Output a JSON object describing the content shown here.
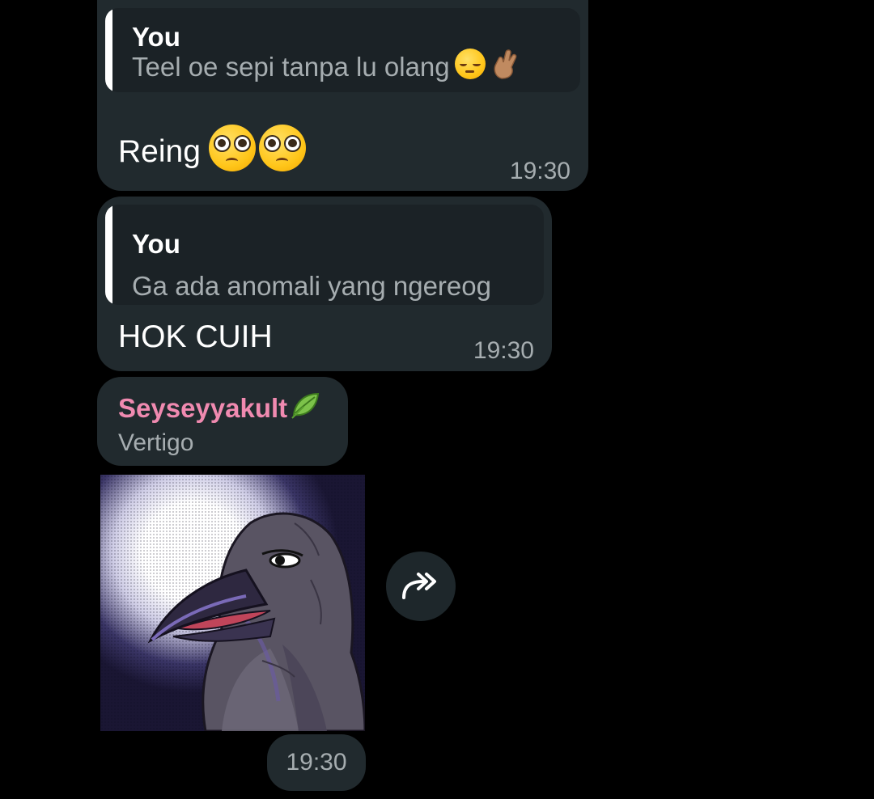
{
  "messages": [
    {
      "reply": {
        "author": "You",
        "text": "Teel oe sepi tanpa lu olang",
        "emoji": [
          "pensive-face",
          "crossed-fingers-medium-skin"
        ]
      },
      "text": "Reing",
      "emoji": [
        "pleading-face",
        "pleading-face"
      ],
      "time": "19:30"
    },
    {
      "reply": {
        "author": "You",
        "text": "Ga ada anomali yang ngereog"
      },
      "text": "HOK CUIH",
      "time": "19:30"
    },
    {
      "sender": "Seyseyyakult",
      "sender_emoji": "leaf-fluttering-in-wind",
      "sender_color": "#f08ab0",
      "subtitle": "Vertigo",
      "sticker": "crow-with-moon-sticker",
      "forward_icon": "share-forward-icon",
      "time": "19:30"
    }
  ],
  "colors": {
    "background": "#000000",
    "bubble": "#212a2e",
    "reply_bg": "#1b2226",
    "secondary_text": "#a6adb0"
  }
}
